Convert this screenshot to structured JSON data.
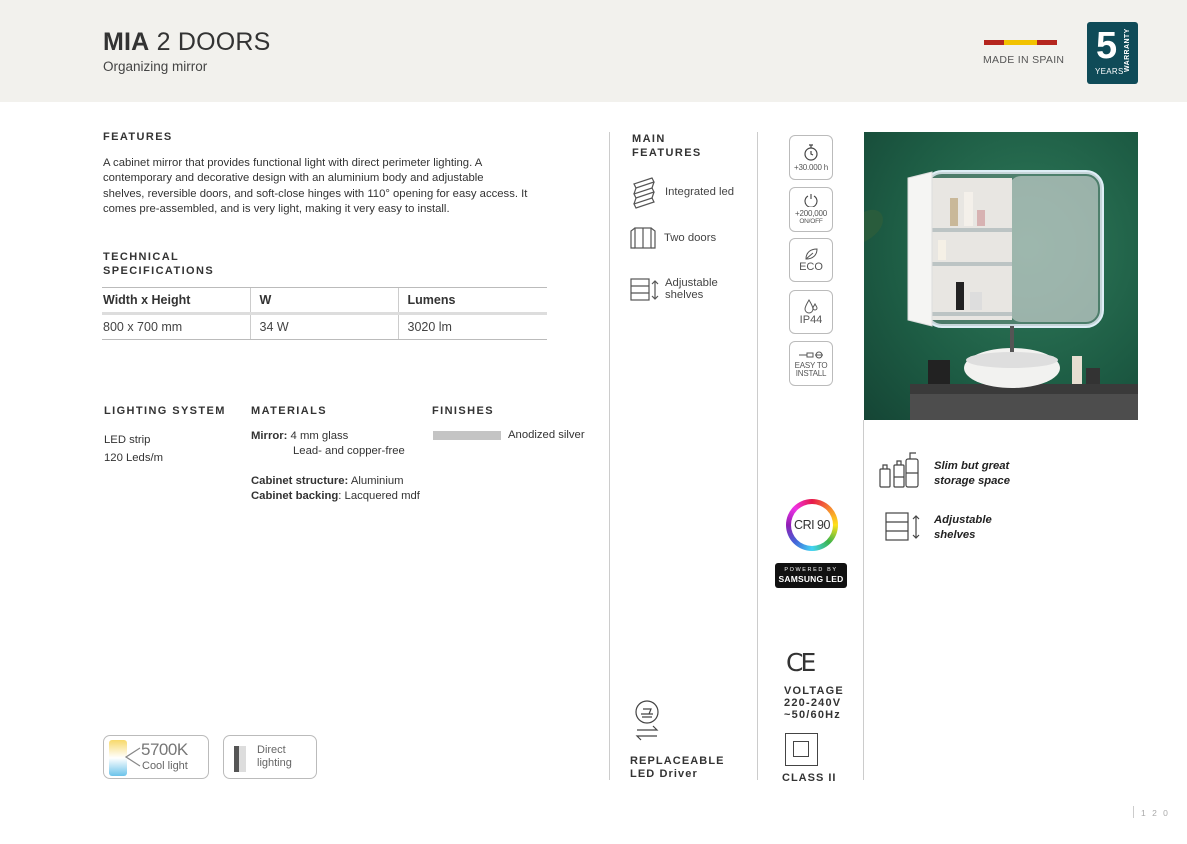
{
  "header": {
    "title_bold": "MIA",
    "title_light": "2 DOORS",
    "subtitle": "Organizing mirror",
    "made_in": "MADE IN SPAIN",
    "warranty": {
      "number": "5",
      "years": "YEARS",
      "label": "WARRANTY"
    },
    "flag_colors": [
      "#b5261e",
      "#f2c200",
      "#b5261e"
    ]
  },
  "features": {
    "heading": "FEATURES",
    "lines": [
      "A cabinet mirror that provides functional light with direct perimeter lighting. A",
      "contemporary and decorative design with an aluminium body and adjustable",
      "shelves, reversible doors, and soft-close hinges with 110° opening for easy access. It",
      "comes pre-assembled, and is  very light, making it very easy to install."
    ]
  },
  "technical": {
    "heading_line1": "TECHNICAL",
    "heading_line2": "SPECIFICATIONS",
    "columns": [
      "Width x Height",
      "W",
      "Lumens"
    ],
    "row": [
      "800 x 700 mm",
      "34 W",
      "3020 lm"
    ]
  },
  "lighting": {
    "heading": "LIGHTING SYSTEM",
    "line1": "LED strip",
    "line2": "120 Leds/m"
  },
  "materials": {
    "heading": "MATERIALS",
    "mirror_label": "Mirror:",
    "mirror_value": "4 mm glass",
    "mirror_value2": "Lead- and copper-free",
    "structure_label": "Cabinet structure:",
    "structure_value": "Aluminium",
    "backing_label": "Cabinet backing",
    "backing_value": ": Lacquered mdf"
  },
  "finishes": {
    "heading": "FINISHES",
    "swatch_color": "#c4c4c4",
    "label": "Anodized silver"
  },
  "main_features": {
    "heading_line1": "MAIN",
    "heading_line2": "FEATURES",
    "items": [
      {
        "icon": "led-strip-icon",
        "label": "Integrated led"
      },
      {
        "icon": "two-doors-icon",
        "label": "Two doors"
      },
      {
        "icon": "adjustable-shelves-icon",
        "label1": "Adjustable",
        "label2": "shelves"
      }
    ],
    "driver_line1": "REPLACEABLE",
    "driver_line2": "LED Driver"
  },
  "badges": {
    "hours": "+30.000 h",
    "onoff_value": "+200,000",
    "onoff_label": "ON/OFF",
    "eco": "ECO",
    "ip": "IP44",
    "install_line1": "EASY TO",
    "install_line2": "INSTALL",
    "cri": "CRI 90",
    "samsung_line1": "POWERED BY",
    "samsung_line2": "SAMSUNG LED",
    "ce": "CE",
    "voltage_line1": "VOLTAGE",
    "voltage_line2": "220-240V",
    "voltage_line3": "~50/60Hz",
    "class": "CLASS II"
  },
  "right_features": {
    "storage_line1": "Slim but great",
    "storage_line2": "storage space",
    "shelves_line1": "Adjustable",
    "shelves_line2": "shelves"
  },
  "bottom_cards": {
    "temp_value": "5700K",
    "temp_label": "Cool light",
    "direct_line1": "Direct",
    "direct_line2": "lighting"
  },
  "page_number": "1 2 0"
}
